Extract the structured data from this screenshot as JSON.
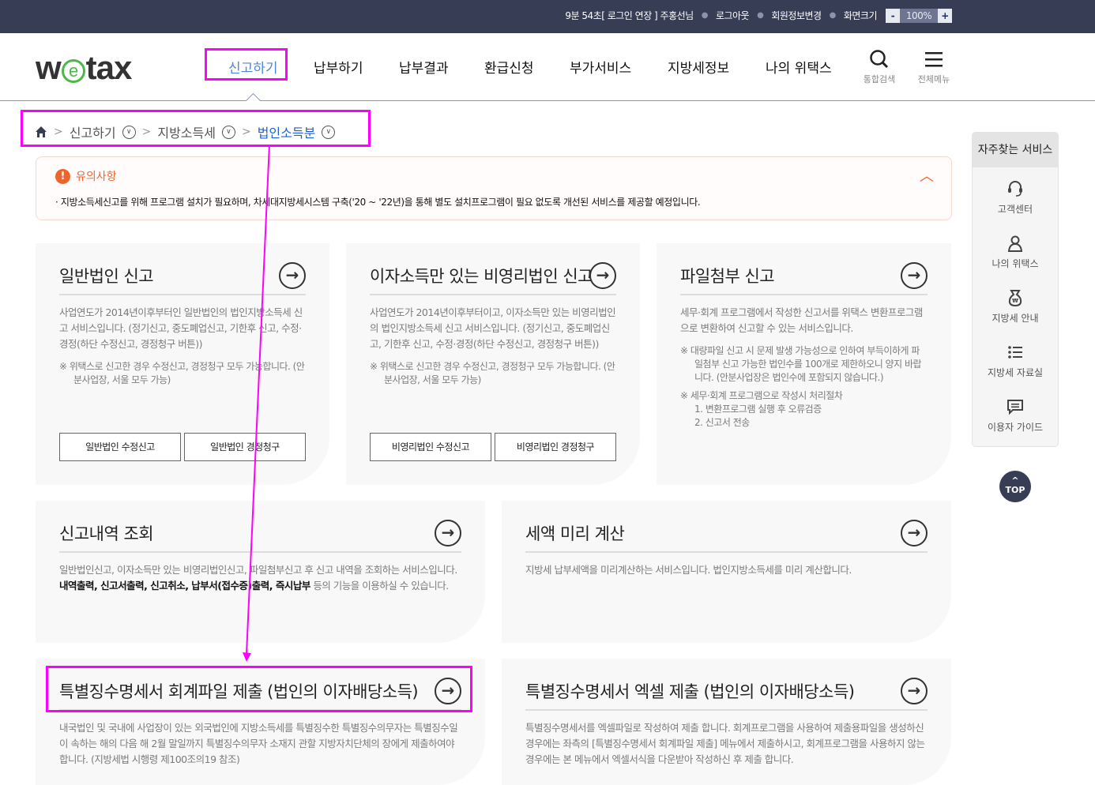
{
  "topbar": {
    "session": "9분 54초[ 로그인 연장 ] 주홍선님",
    "logout": "로그아웃",
    "member_edit": "회원정보변경",
    "screen_size": "화면크기",
    "zoom_minus": "-",
    "zoom_value": "100%",
    "zoom_plus": "+"
  },
  "header": {
    "logo": "wetax",
    "nav": [
      "신고하기",
      "납부하기",
      "납부결과",
      "환급신청",
      "부가서비스",
      "지방세정보",
      "나의 위택스"
    ],
    "search_label": "통합검색",
    "menu_label": "전체메뉴"
  },
  "breadcrumb": [
    "신고하기",
    "지방소득세",
    "법인소득분"
  ],
  "notice": {
    "title": "유의사항",
    "body": "· 지방소득세신고를 위해 프로그램 설치가 필요하며, 차세대지방세시스템 구축('20 ~ '22년)을 통해 별도 설치프로그램이 필요 없도록 개선된 서비스를 제공할 예정입니다."
  },
  "cards": [
    {
      "title": "일반법인 신고",
      "desc": "사업연도가 2014년이후부터인 일반법인의 법인지방소득세 신고 서비스입니다. (정기신고, 중도폐업신고, 기한후 신고, 수정·경정(하단 수정신고, 경정청구 버튼))",
      "notes": [
        "※ 위택스로 신고한 경우 수정신고, 경정청구 모두 가능합니다. (안분사업장, 서울 모두 가능)"
      ],
      "buttons": [
        "일반법인 수정신고",
        "일반법인 경정청구"
      ]
    },
    {
      "title": "이자소득만 있는 비영리법인 신고",
      "desc": "사업연도가 2014년이후부터이고, 이자소득만 있는 비영리법인의 법인지방소득세 신고 서비스입니다. (정기신고, 중도폐업신고, 기한후 신고, 수정·경정(하단 수정신고, 경정청구 버튼))",
      "notes": [
        "※ 위택스로 신고한 경우 수정신고, 경정청구 모두 가능합니다. (안분사업장, 서울 모두 가능)"
      ],
      "buttons": [
        "비영리법인 수정신고",
        "비영리법인 경정청구"
      ]
    },
    {
      "title": "파일첨부 신고",
      "desc": "세무·회계 프로그램에서 작성한 신고서를 위택스 변환프로그램으로 변환하여 신고할 수 있는 서비스입니다.",
      "notes": [
        "※ 대량파일 신고 시 문제 발생 가능성으로 인하여 부득이하게 파일첨부 신고 가능한 법인수를 100개로 제한하오니 양지 바랍니다. (안분사업장은 법인수에 포함되지 않습니다.)",
        "※ 세무·회계 프로그램으로 작성시 처리절차",
        "1. 변환프로그램 실행 후 오류검증",
        "2. 신고서 전송"
      ]
    },
    {
      "title": "신고내역 조회",
      "desc_pre": "일반법인신고, 이자소득만 있는 비영리법인신고, 파일첨부신고 후 신고 내역을 조회하는 서비스입니다. ",
      "desc_bold": "내역출력, 신고서출력, 신고취소, 납부서(접수증)출력, 즉시납부",
      "desc_post": " 등의 기능을 이용하실 수 있습니다."
    },
    {
      "title": "세액 미리 계산",
      "desc": "지방세 납부세액을 미리계산하는 서비스입니다. 법인지방소득세를 미리 계산합니다."
    },
    {
      "title": "특별징수명세서 회계파일 제출 (법인의 이자배당소득)",
      "desc": "내국법인 및 국내에 사업장이 있는 외국법인에 지방소득세를 특별징수한 특별징수의무자는 특별징수일이 속하는 해의 다음 해 2월 말일까지 특별징수의무자 소재지 관할 지방자치단체의 장에게 제출하여야 합니다. (지방세법 시행령 제100조의19 참조)"
    },
    {
      "title": "특별징수명세서 엑셀 제출 (법인의 이자배당소득)",
      "desc": "특별징수명세서를 엑셀파일로 작성하여 제출 합니다. 회계프로그램을 사용하여 제출용파일을 생성하신 경우에는 좌측의 [특별징수명세서 회계파일 제출] 메뉴에서 제출하시고, 회계프로그램을 사용하지 않는 경우에는 본 메뉴에서 엑셀서식을 다운받아 작성하신 후 제출 합니다."
    }
  ],
  "sidebar": {
    "title": "자주찾는 서비스",
    "items": [
      "고객센터",
      "나의 위택스",
      "지방세 안내",
      "지방세 자료실",
      "이용자 가이드"
    ],
    "top": "TOP"
  }
}
